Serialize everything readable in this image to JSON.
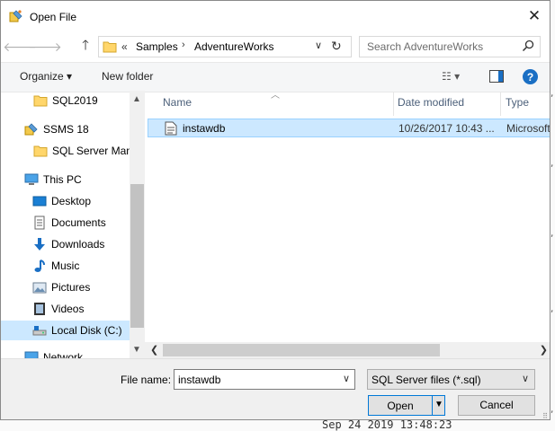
{
  "window": {
    "title": "Open File",
    "close_glyph": "✕"
  },
  "address": {
    "prefix": "«",
    "crumbs": [
      "Samples",
      "AdventureWorks"
    ],
    "separator": "›",
    "search_placeholder": "Search AdventureWorks"
  },
  "toolbar": {
    "organize_label": "Organize ▾",
    "new_folder_label": "New folder",
    "help_label": "?"
  },
  "nav": {
    "items": [
      {
        "label": "SQL2019",
        "icon": "folder-icon"
      },
      {
        "label": "SSMS 18",
        "icon": "ssms-icon"
      },
      {
        "label": "SQL Server Mana",
        "icon": "folder-icon"
      },
      {
        "label": "This PC",
        "icon": "computer-icon"
      },
      {
        "label": "Desktop",
        "icon": "desktop-icon"
      },
      {
        "label": "Documents",
        "icon": "documents-icon"
      },
      {
        "label": "Downloads",
        "icon": "downloads-icon"
      },
      {
        "label": "Music",
        "icon": "music-icon"
      },
      {
        "label": "Pictures",
        "icon": "pictures-icon"
      },
      {
        "label": "Videos",
        "icon": "videos-icon"
      },
      {
        "label": "Local Disk (C:)",
        "icon": "local-disk-icon",
        "selected": true
      },
      {
        "label": "Network",
        "icon": "network-icon"
      }
    ]
  },
  "filelist": {
    "columns": {
      "name": "Name",
      "date": "Date modified",
      "type": "Type"
    },
    "rows": [
      {
        "name": "instawdb",
        "date": "10/26/2017 10:43 ...",
        "type": "Microsoft",
        "selected": true
      }
    ]
  },
  "bottom": {
    "filename_label": "File name:",
    "filename_value": "instawdb",
    "filetype_value": "SQL Server files (*.sql)",
    "open_label": "Open",
    "cancel_label": "Cancel"
  },
  "background": {
    "timestamp": "Sep 24 2019 13:48:23"
  },
  "colors": {
    "accent": "#0078d7",
    "selection": "#cce8ff",
    "selection_border": "#99d1ff"
  }
}
